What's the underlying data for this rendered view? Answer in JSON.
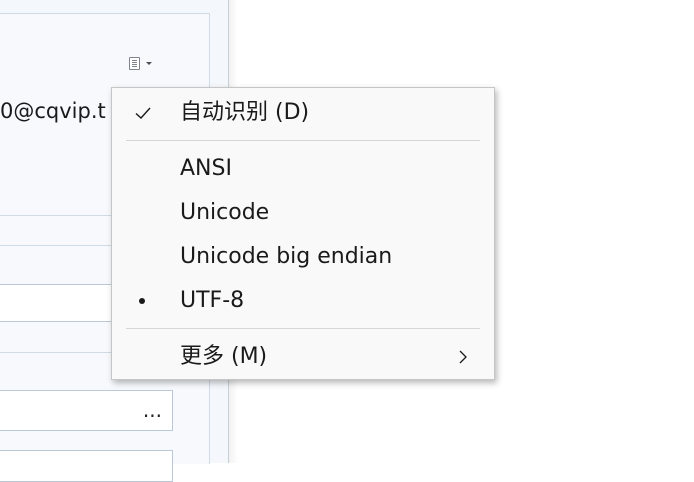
{
  "background": {
    "email_fragment": "0@cqvip.t",
    "browse_label": "...",
    "encoding_button_icon": "document-icon"
  },
  "menu": {
    "items": [
      {
        "label": "自动识别 (D)",
        "state": "checked"
      },
      {
        "label": "ANSI",
        "state": "none"
      },
      {
        "label": "Unicode",
        "state": "none"
      },
      {
        "label": "Unicode big endian",
        "state": "none"
      },
      {
        "label": "UTF-8",
        "state": "selected"
      },
      {
        "label": "更多 (M)",
        "state": "submenu"
      }
    ]
  },
  "colors": {
    "menu_bg": "#f9f9f9",
    "menu_border": "#c6c6c6",
    "separator": "#d6d6d6",
    "text": "#1a1a1a",
    "panel_border": "#cfdbe6"
  }
}
